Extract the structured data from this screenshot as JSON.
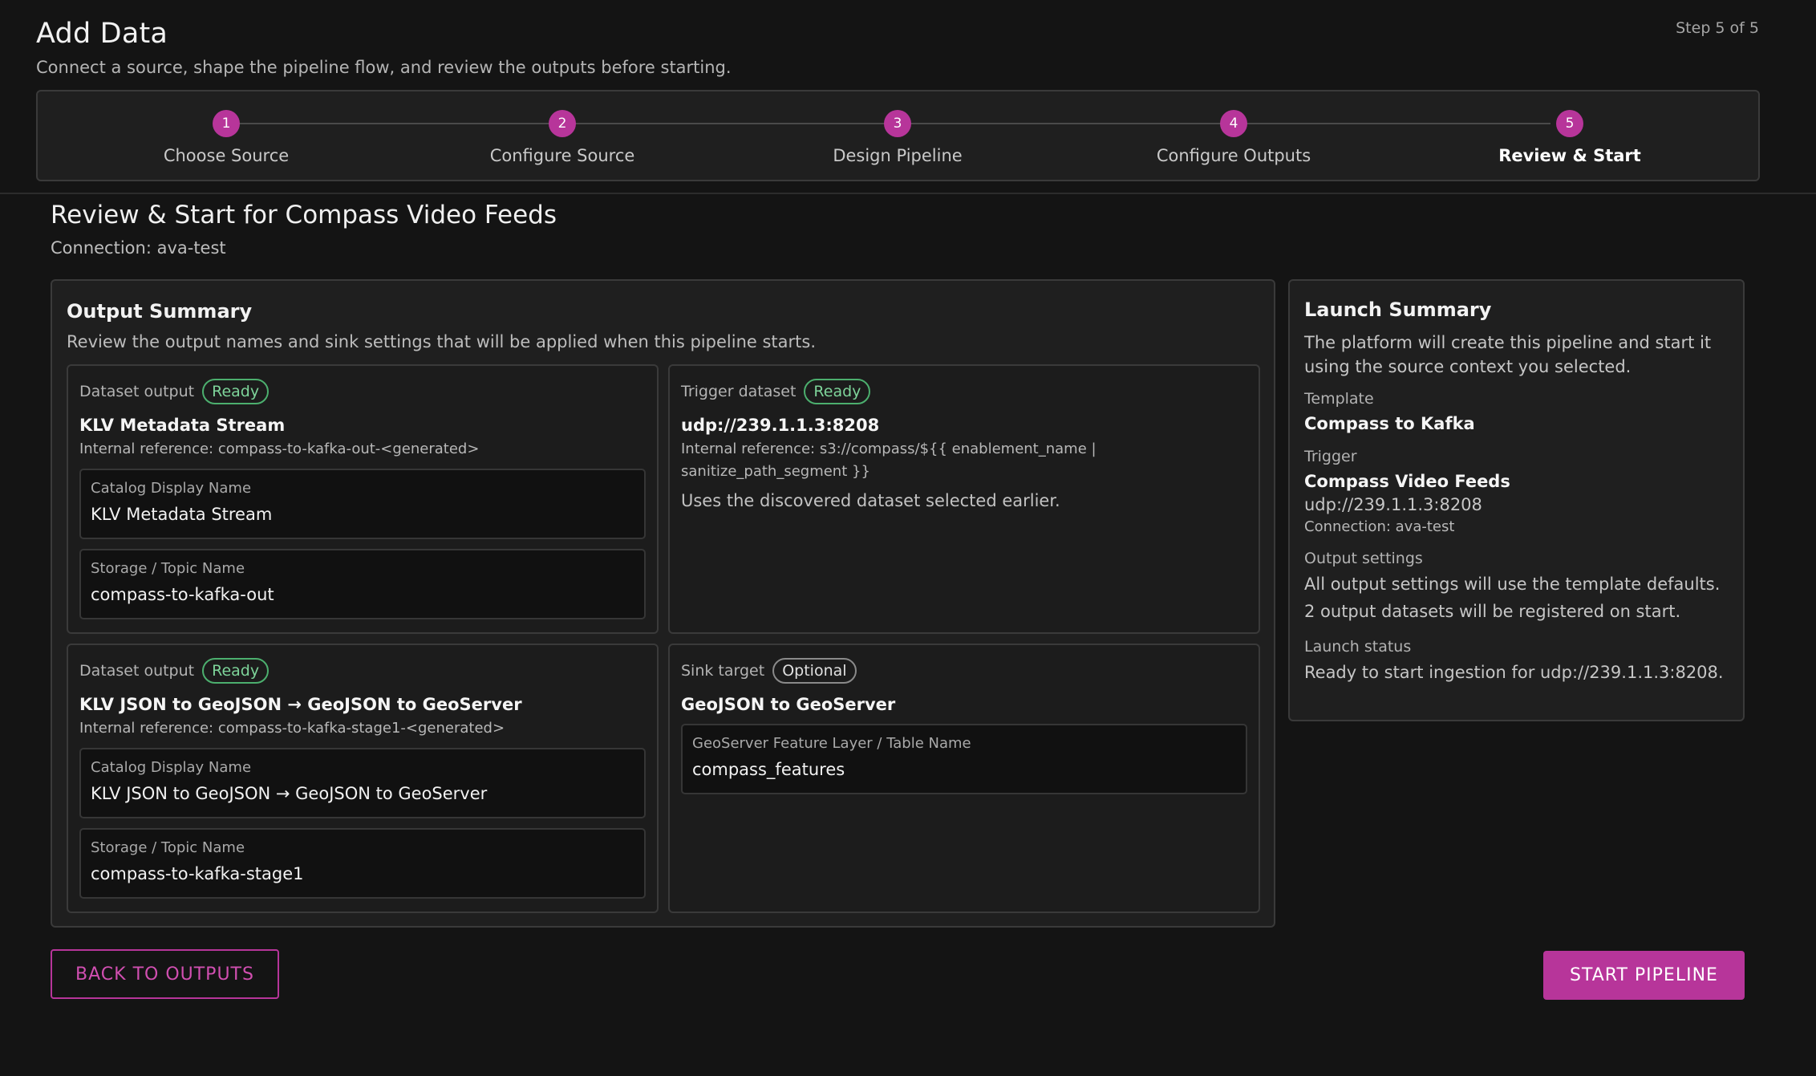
{
  "header": {
    "title": "Add Data",
    "subtitle": "Connect a source, shape the pipeline flow, and review the outputs before starting.",
    "step_count": "Step 5 of 5"
  },
  "stepper": {
    "steps": [
      {
        "number": "1",
        "label": "Choose Source"
      },
      {
        "number": "2",
        "label": "Configure Source"
      },
      {
        "number": "3",
        "label": "Design Pipeline"
      },
      {
        "number": "4",
        "label": "Configure Outputs"
      },
      {
        "number": "5",
        "label": "Review & Start"
      }
    ],
    "active_step": 5
  },
  "section": {
    "title": "Review & Start for Compass Video Feeds",
    "connection": "Connection: ava-test"
  },
  "output_summary": {
    "title": "Output Summary",
    "description": "Review the output names and sink settings that will be applied when this pipeline starts.",
    "cards": [
      {
        "kicker": "Dataset output",
        "badge": "Ready",
        "name": "KLV Metadata Stream",
        "ref": "Internal reference: compass-to-kafka-out-<generated>",
        "fields": [
          {
            "label": "Catalog Display Name",
            "value": "KLV Metadata Stream"
          },
          {
            "label": "Storage / Topic Name",
            "value": "compass-to-kafka-out"
          }
        ]
      },
      {
        "kicker": "Trigger dataset",
        "badge": "Ready",
        "name": "udp://239.1.1.3:8208",
        "ref": "Internal reference: s3://compass/${{ enablement_name | sanitize_path_segment }}",
        "note": "Uses the discovered dataset selected earlier."
      },
      {
        "kicker": "Dataset output",
        "badge": "Ready",
        "name": "KLV JSON to GeoJSON → GeoJSON to GeoServer",
        "ref": "Internal reference: compass-to-kafka-stage1-<generated>",
        "fields": [
          {
            "label": "Catalog Display Name",
            "value": "KLV JSON to GeoJSON → GeoJSON to GeoServer"
          },
          {
            "label": "Storage / Topic Name",
            "value": "compass-to-kafka-stage1"
          }
        ]
      },
      {
        "kicker": "Sink target",
        "badge": "Optional",
        "name": "GeoJSON to GeoServer",
        "fields": [
          {
            "label": "GeoServer Feature Layer / Table Name",
            "value": "compass_features"
          }
        ]
      }
    ]
  },
  "launch_summary": {
    "title": "Launch Summary",
    "description": "The platform will create this pipeline and start it using the source context you selected.",
    "template_label": "Template",
    "template_value": "Compass to Kafka",
    "trigger_label": "Trigger",
    "trigger_name": "Compass Video Feeds",
    "trigger_address": "udp://239.1.1.3:8208",
    "trigger_connection": "Connection: ava-test",
    "output_settings_label": "Output settings",
    "output_settings_line1": "All output settings will use the template defaults.",
    "output_settings_line2": "2 output datasets will be registered on start.",
    "launch_status_label": "Launch status",
    "launch_status_value": "Ready to start ingestion for udp://239.1.1.3:8208."
  },
  "actions": {
    "back_label": "BACK TO OUTPUTS",
    "start_label": "START PIPELINE"
  },
  "colors": {
    "accent": "#b7359a",
    "ready": "#4caf6e",
    "background": "#141414",
    "panel": "#1f1f1f"
  }
}
